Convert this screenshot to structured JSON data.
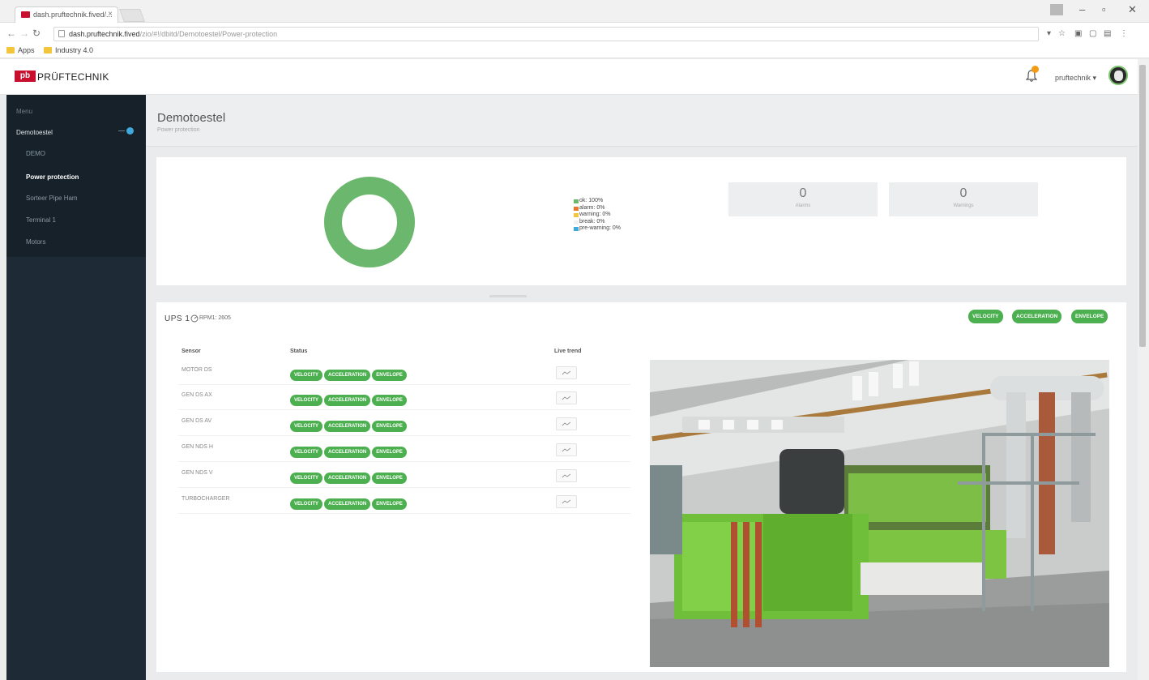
{
  "browser": {
    "tab_title": "dash.pruftechnik.fived/...",
    "tab_close": "×",
    "url_host": "dash.pruftechnik.fived",
    "url_path": "/zio/#!/dbitd/Demotoestel/Power-protection",
    "bookmarks": [
      "Apps",
      "Industry 4.0"
    ],
    "window_controls": [
      "–",
      "▫",
      "✕"
    ]
  },
  "header": {
    "logo_mark": "pb",
    "brand": "PRÜFTECHNIK",
    "user": "pruftechnik ▾"
  },
  "sidebar": {
    "section_label": "Menu",
    "group": "Demotoestel",
    "items": [
      "DEMO",
      "Power protection",
      "Sorteer Pipe Ham",
      "Terminal 1",
      "Motors"
    ]
  },
  "page": {
    "title": "Demotoestel",
    "subtitle": "Power protection"
  },
  "summary": {
    "legend": [
      {
        "label": "ok: 100%",
        "color": "#6ab76d"
      },
      {
        "label": "alarm: 0%",
        "color": "#e8772e"
      },
      {
        "label": "warning: 0%",
        "color": "#f4c542"
      },
      {
        "label": "break: 0%",
        "color": "#f0f0f0"
      },
      {
        "label": "pre-warning: 0%",
        "color": "#3fa9dc"
      }
    ],
    "kpis": [
      {
        "value": "0",
        "label": "Alarms"
      },
      {
        "value": "0",
        "label": "Warnings"
      }
    ],
    "donut_ok_fraction": 1.0
  },
  "ups": {
    "title": "UPS 1",
    "rpm": "RPM1: 2605",
    "header_buttons": [
      "VELOCITY",
      "ACCELERATION",
      "ENVELOPE"
    ],
    "columns": [
      "Sensor",
      "Status",
      "Live trend"
    ],
    "rows": [
      {
        "name": "MOTOR DS",
        "buttons": [
          "VELOCITY",
          "ACCELERATION",
          "ENVELOPE"
        ]
      },
      {
        "name": "GEN DS AX",
        "buttons": [
          "VELOCITY",
          "ACCELERATION",
          "ENVELOPE"
        ]
      },
      {
        "name": "GEN DS AV",
        "buttons": [
          "VELOCITY",
          "ACCELERATION",
          "ENVELOPE"
        ]
      },
      {
        "name": "GEN NDS H",
        "buttons": [
          "VELOCITY",
          "ACCELERATION",
          "ENVELOPE"
        ]
      },
      {
        "name": "GEN NDS V",
        "buttons": [
          "VELOCITY",
          "ACCELERATION",
          "ENVELOPE"
        ]
      },
      {
        "name": "TURBOCHARGER",
        "buttons": [
          "VELOCITY",
          "ACCELERATION",
          "ENVELOPE"
        ]
      }
    ],
    "trend_glyph": "⌁"
  },
  "colors": {
    "ok_green": "#4caf50",
    "donut_green": "#6ab76d",
    "sidebar_bg": "#1e2a36",
    "brand_red": "#c8102e"
  }
}
